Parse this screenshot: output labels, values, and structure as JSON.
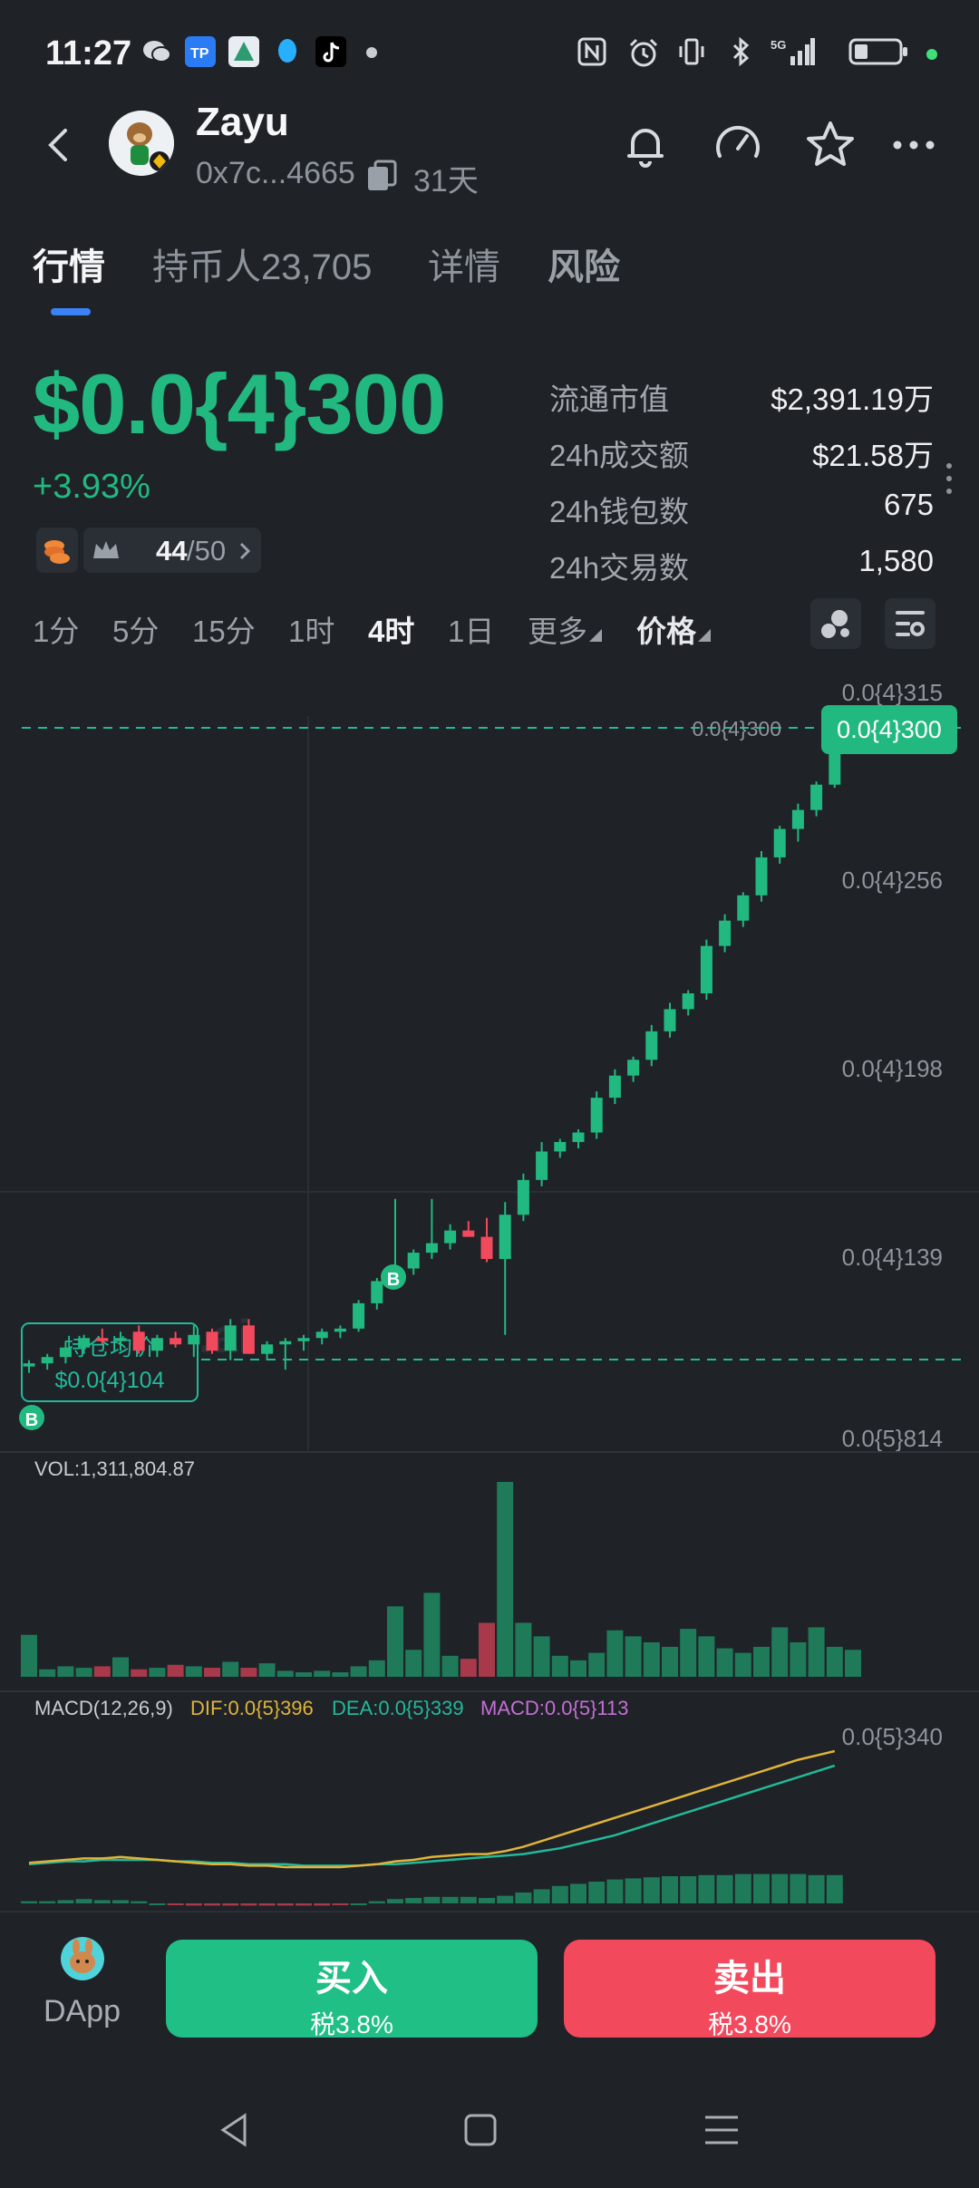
{
  "status_bar": {
    "time": "11:27"
  },
  "header": {
    "name": "Zayu",
    "address": "0x7c...4665",
    "age": "31天"
  },
  "tabs": [
    {
      "label": "行情",
      "active": true
    },
    {
      "label": "持币人23,705",
      "active": false
    },
    {
      "label": "详情",
      "active": false
    },
    {
      "label": "风险",
      "active": false
    }
  ],
  "price": {
    "value": "$0.0{4}300",
    "change": "+3.93%"
  },
  "badges": {
    "rank": "44",
    "rank_total": "/50"
  },
  "stats": [
    {
      "label": "流通市值",
      "value": "$2,391.19万"
    },
    {
      "label": "24h成交额",
      "value": "$21.58万"
    },
    {
      "label": "24h钱包数",
      "value": "675"
    },
    {
      "label": "24h交易数",
      "value": "1,580"
    }
  ],
  "intervals": [
    {
      "label": "1分",
      "active": false
    },
    {
      "label": "5分",
      "active": false
    },
    {
      "label": "15分",
      "active": false
    },
    {
      "label": "1时",
      "active": false
    },
    {
      "label": "4时",
      "active": true
    },
    {
      "label": "1日",
      "active": false
    },
    {
      "label": "更多",
      "active": false
    },
    {
      "label": "价格",
      "active": false
    }
  ],
  "chart": {
    "y_ticks": [
      "0.0{4}315",
      "0.0{4}256",
      "0.0{4}198",
      "0.0{4}139",
      "0.0{5}814"
    ],
    "current_price_tag": "0.0{4}300",
    "current_line_label": "0.0{4}300",
    "avg_label": "持仓均价",
    "avg_value": "$0.0{4}104",
    "marker_b": "B",
    "vol_label": "VOL:1,311,804.87",
    "macd": {
      "label": "MACD(12,26,9)",
      "dif": "DIF:0.0{5}396",
      "dea": "DEA:0.0{5}339",
      "macd": "MACD:0.0{5}113",
      "y_tick": "0.0{5}340"
    },
    "colors": {
      "up": "#22b980",
      "down": "#f3495d",
      "dif": "#e0b33a",
      "dea": "#22b99a",
      "macd": "#c46fd6"
    }
  },
  "chart_data": {
    "type": "candlestick",
    "interval": "4时",
    "y_scale_units": "1e-5",
    "ylim": [
      8.14,
      31.5
    ],
    "candles": [
      {
        "o": 10.5,
        "h": 10.7,
        "l": 10.3,
        "c": 10.6
      },
      {
        "o": 10.6,
        "h": 10.9,
        "l": 10.4,
        "c": 10.8
      },
      {
        "o": 10.8,
        "h": 11.3,
        "l": 10.6,
        "c": 11.1
      },
      {
        "o": 11.1,
        "h": 11.5,
        "l": 10.9,
        "c": 11.4
      },
      {
        "o": 11.4,
        "h": 11.7,
        "l": 11.2,
        "c": 11.3
      },
      {
        "o": 11.3,
        "h": 11.6,
        "l": 11.0,
        "c": 11.4
      },
      {
        "o": 11.6,
        "h": 11.8,
        "l": 10.9,
        "c": 11.0
      },
      {
        "o": 11.0,
        "h": 11.5,
        "l": 10.8,
        "c": 11.4
      },
      {
        "o": 11.4,
        "h": 11.6,
        "l": 11.1,
        "c": 11.2
      },
      {
        "o": 11.2,
        "h": 11.8,
        "l": 10.8,
        "c": 11.5
      },
      {
        "o": 11.6,
        "h": 11.7,
        "l": 10.9,
        "c": 11.0
      },
      {
        "o": 11.0,
        "h": 12.0,
        "l": 10.7,
        "c": 11.8
      },
      {
        "o": 11.8,
        "h": 12.0,
        "l": 10.9,
        "c": 10.9
      },
      {
        "o": 10.9,
        "h": 11.3,
        "l": 10.7,
        "c": 11.2
      },
      {
        "o": 11.2,
        "h": 11.4,
        "l": 10.4,
        "c": 11.3
      },
      {
        "o": 11.3,
        "h": 11.5,
        "l": 11.0,
        "c": 11.4
      },
      {
        "o": 11.4,
        "h": 11.7,
        "l": 11.2,
        "c": 11.6
      },
      {
        "o": 11.6,
        "h": 11.8,
        "l": 11.4,
        "c": 11.7
      },
      {
        "o": 11.7,
        "h": 12.6,
        "l": 11.6,
        "c": 12.5
      },
      {
        "o": 12.5,
        "h": 13.3,
        "l": 12.3,
        "c": 13.2
      },
      {
        "o": 13.2,
        "h": 15.8,
        "l": 13.0,
        "c": 13.6
      },
      {
        "o": 13.6,
        "h": 14.2,
        "l": 13.4,
        "c": 14.1
      },
      {
        "o": 14.1,
        "h": 15.8,
        "l": 13.9,
        "c": 14.4
      },
      {
        "o": 14.4,
        "h": 15.0,
        "l": 14.2,
        "c": 14.8
      },
      {
        "o": 14.8,
        "h": 15.1,
        "l": 14.6,
        "c": 14.6
      },
      {
        "o": 14.6,
        "h": 15.2,
        "l": 13.8,
        "c": 13.9
      },
      {
        "o": 13.9,
        "h": 15.7,
        "l": 11.5,
        "c": 15.3
      },
      {
        "o": 15.3,
        "h": 16.6,
        "l": 15.1,
        "c": 16.4
      },
      {
        "o": 16.4,
        "h": 17.6,
        "l": 16.2,
        "c": 17.3
      },
      {
        "o": 17.3,
        "h": 17.7,
        "l": 17.1,
        "c": 17.6
      },
      {
        "o": 17.6,
        "h": 18.0,
        "l": 17.4,
        "c": 17.9
      },
      {
        "o": 17.9,
        "h": 19.2,
        "l": 17.7,
        "c": 19.0
      },
      {
        "o": 19.0,
        "h": 19.9,
        "l": 18.8,
        "c": 19.7
      },
      {
        "o": 19.7,
        "h": 20.3,
        "l": 19.5,
        "c": 20.2
      },
      {
        "o": 20.2,
        "h": 21.3,
        "l": 20.0,
        "c": 21.1
      },
      {
        "o": 21.1,
        "h": 22.0,
        "l": 20.9,
        "c": 21.8
      },
      {
        "o": 21.8,
        "h": 22.4,
        "l": 21.6,
        "c": 22.3
      },
      {
        "o": 22.3,
        "h": 24.0,
        "l": 22.1,
        "c": 23.8
      },
      {
        "o": 23.8,
        "h": 24.8,
        "l": 23.6,
        "c": 24.6
      },
      {
        "o": 24.6,
        "h": 25.5,
        "l": 24.4,
        "c": 25.4
      },
      {
        "o": 25.4,
        "h": 26.8,
        "l": 25.2,
        "c": 26.6
      },
      {
        "o": 26.6,
        "h": 27.6,
        "l": 26.4,
        "c": 27.5
      },
      {
        "o": 27.5,
        "h": 28.3,
        "l": 27.1,
        "c": 28.1
      },
      {
        "o": 28.1,
        "h": 29.0,
        "l": 27.9,
        "c": 28.9
      },
      {
        "o": 28.9,
        "h": 30.1,
        "l": 28.8,
        "c": 30.0
      }
    ],
    "volume": [
      28,
      5,
      7,
      6,
      7,
      13,
      5,
      6,
      8,
      7,
      6,
      10,
      6,
      9,
      4,
      3,
      4,
      3,
      7,
      11,
      47,
      18,
      56,
      14,
      12,
      36,
      130,
      36,
      27,
      14,
      11,
      16,
      31,
      27,
      23,
      20,
      32,
      27,
      19,
      16,
      20,
      33,
      23,
      33,
      20,
      18
    ],
    "dif": [
      2.3,
      2.4,
      2.5,
      2.6,
      2.6,
      2.7,
      2.6,
      2.5,
      2.4,
      2.3,
      2.2,
      2.2,
      2.1,
      2.1,
      2.0,
      2.0,
      2.0,
      2.0,
      2.1,
      2.2,
      2.4,
      2.5,
      2.7,
      2.8,
      2.9,
      2.9,
      3.1,
      3.4,
      3.8,
      4.2,
      4.6,
      5.0,
      5.4,
      5.8,
      6.2,
      6.6,
      7.0,
      7.4,
      7.8,
      8.2,
      8.6,
      9.0,
      9.4,
      9.7,
      10.0
    ],
    "dea": [
      2.2,
      2.3,
      2.4,
      2.4,
      2.5,
      2.5,
      2.5,
      2.5,
      2.4,
      2.4,
      2.3,
      2.3,
      2.2,
      2.2,
      2.2,
      2.1,
      2.1,
      2.1,
      2.1,
      2.2,
      2.2,
      2.3,
      2.4,
      2.5,
      2.6,
      2.7,
      2.8,
      2.9,
      3.1,
      3.3,
      3.6,
      3.9,
      4.2,
      4.6,
      5.0,
      5.4,
      5.8,
      6.2,
      6.6,
      7.0,
      7.4,
      7.8,
      8.2,
      8.6,
      9.0
    ],
    "macd_hist": [
      0.2,
      0.2,
      0.3,
      0.4,
      0.3,
      0.3,
      0.2,
      0,
      -0.1,
      -0.2,
      -0.2,
      -0.2,
      -0.2,
      -0.2,
      -0.2,
      -0.2,
      -0.2,
      -0.1,
      0,
      0.2,
      0.4,
      0.5,
      0.6,
      0.6,
      0.6,
      0.5,
      0.7,
      1.0,
      1.3,
      1.6,
      1.8,
      2.0,
      2.2,
      2.3,
      2.4,
      2.5,
      2.5,
      2.6,
      2.6,
      2.7,
      2.7,
      2.7,
      2.7,
      2.6,
      2.6
    ]
  },
  "bottom": {
    "dapp_label": "DApp",
    "buy_label": "买入",
    "buy_tax": "税3.8%",
    "sell_label": "卖出",
    "sell_tax": "税3.8%"
  }
}
